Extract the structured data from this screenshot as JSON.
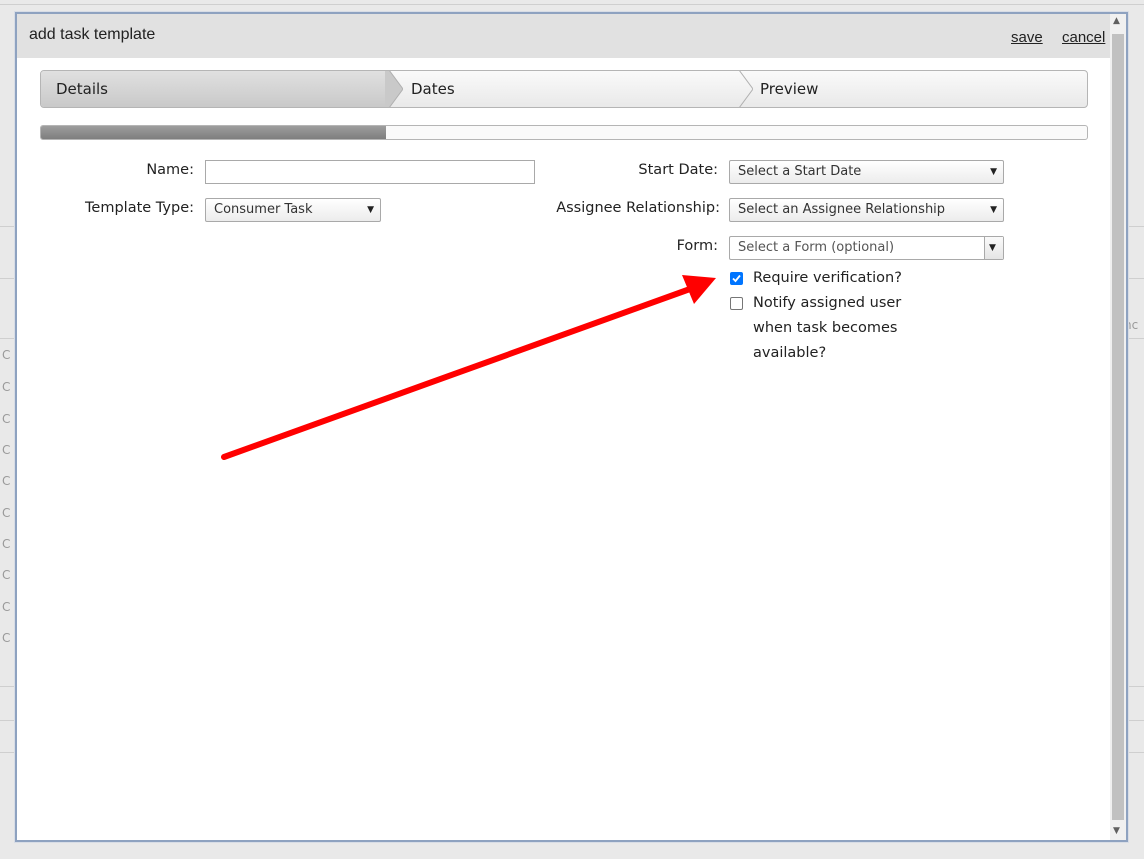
{
  "dialog": {
    "title": "add task template",
    "save_label": "save",
    "cancel_label": "cancel"
  },
  "wizard": {
    "steps": [
      {
        "label": "Details",
        "active": true
      },
      {
        "label": "Dates",
        "active": false
      },
      {
        "label": "Preview",
        "active": false
      }
    ],
    "progress_fraction": 0.33
  },
  "form": {
    "name_label": "Name:",
    "name_value": "",
    "template_type_label": "Template Type:",
    "template_type_value": "Consumer Task",
    "start_date_label": "Start Date:",
    "start_date_value": "Select a Start Date",
    "assignee_label": "Assignee Relationship:",
    "assignee_value": "Select an Assignee Relationship",
    "form_label": "Form:",
    "form_value": "Select a Form (optional)",
    "require_verification_label": "Require verification?",
    "require_verification_checked": true,
    "notify_label": "Notify assigned user when task becomes available?",
    "notify_checked": false
  },
  "annotation": {
    "arrow_color": "#ff0000"
  },
  "background": {
    "partial_text": "nc",
    "row_letters": [
      "C",
      "C",
      "C",
      "C",
      "C",
      "C",
      "C",
      "C",
      "C",
      "C"
    ]
  }
}
